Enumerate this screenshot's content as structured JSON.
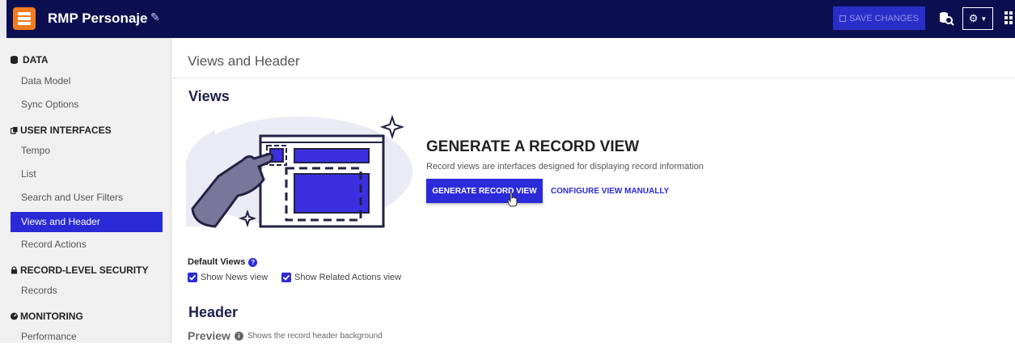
{
  "header": {
    "app_title": "RMP Personaje",
    "save_label": "SAVE CHANGES",
    "colors": {
      "bar": "#0b0f4f",
      "app_icon": "#f07c1f",
      "accent": "#2b2bd9"
    }
  },
  "sidebar": {
    "sections": [
      {
        "title": "DATA",
        "icon": "database-icon",
        "items": [
          {
            "label": "Data Model"
          },
          {
            "label": "Sync Options"
          }
        ]
      },
      {
        "title": "USER INTERFACES",
        "icon": "copy-icon",
        "items": [
          {
            "label": "Tempo"
          },
          {
            "label": "List"
          },
          {
            "label": "Search and User Filters"
          },
          {
            "label": "Views and Header",
            "active": true
          },
          {
            "label": "Record Actions"
          }
        ]
      },
      {
        "title": "RECORD-LEVEL SECURITY",
        "icon": "lock-icon",
        "items": [
          {
            "label": "Records"
          }
        ]
      },
      {
        "title": "MONITORING",
        "icon": "dashboard-icon",
        "items": [
          {
            "label": "Performance"
          }
        ]
      }
    ]
  },
  "main": {
    "page_title": "Views and Header",
    "views_heading": "Views",
    "generate": {
      "title": "GENERATE A RECORD VIEW",
      "description": "Record views are interfaces designed for displaying record information",
      "primary_button": "GENERATE RECORD VIEW",
      "secondary_link": "CONFIGURE VIEW MANUALLY"
    },
    "default_views": {
      "label": "Default Views",
      "options": [
        {
          "label": "Show News view",
          "checked": true
        },
        {
          "label": "Show Related Actions view",
          "checked": true
        }
      ]
    },
    "header_heading": "Header",
    "preview": {
      "label": "Preview",
      "description": "Shows the record header background"
    }
  }
}
